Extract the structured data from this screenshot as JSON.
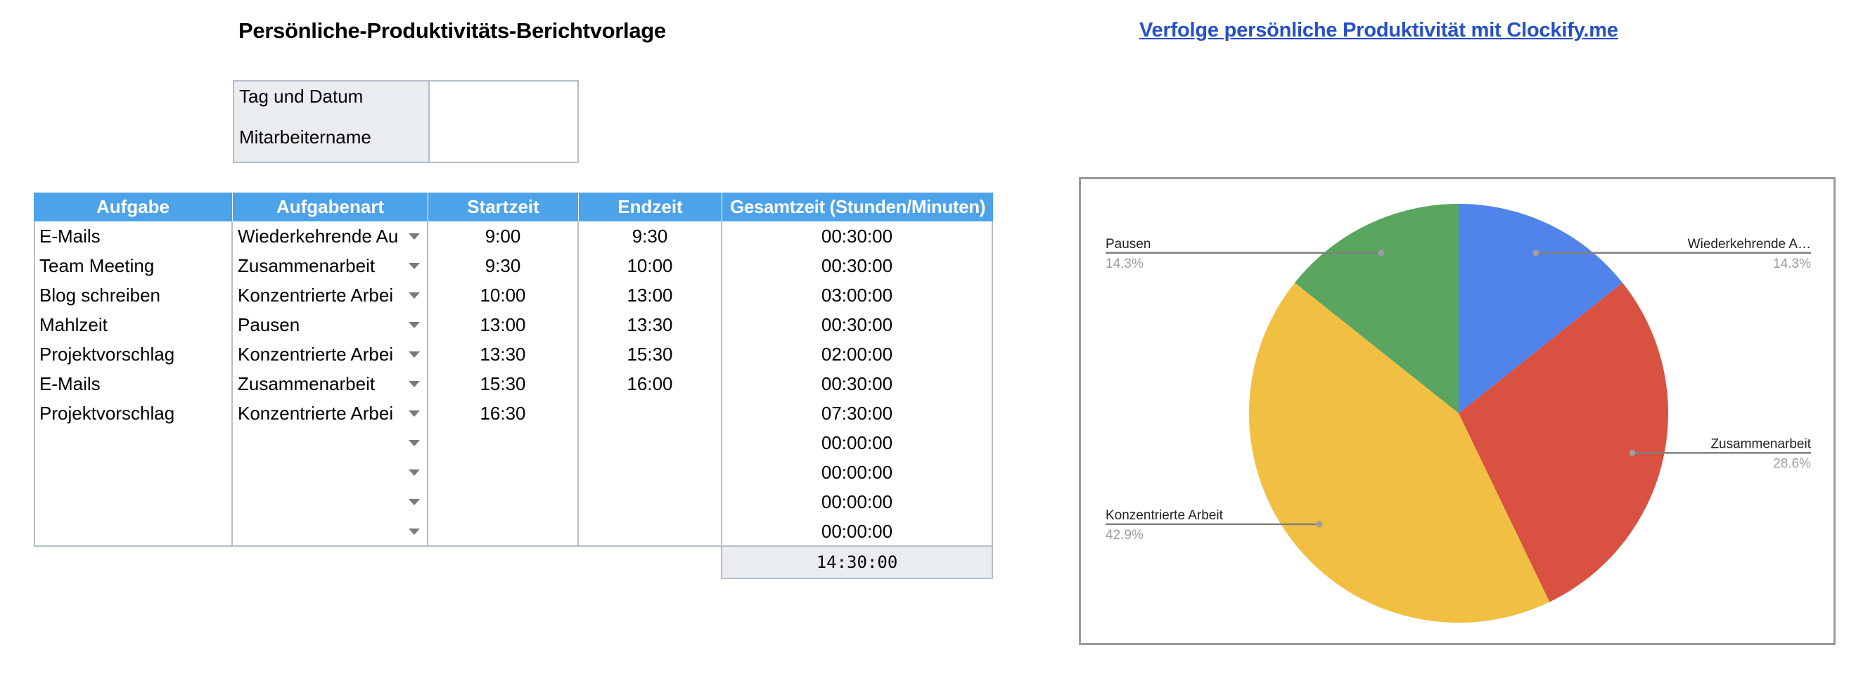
{
  "header": {
    "title": "Persönliche-Produktivitäts-Berichtvorlage",
    "link_text": "Verfolge persönliche Produktivität mit Clockify.me"
  },
  "info": {
    "rows": [
      {
        "label": "Tag und Datum",
        "value": ""
      },
      {
        "label": "Mitarbeitername",
        "value": ""
      }
    ]
  },
  "table": {
    "columns": [
      "Aufgabe",
      "Aufgabenart",
      "Startzeit",
      "Endzeit",
      "Gesamtzeit (Stunden/Minuten)"
    ],
    "rows": [
      {
        "task": "E-Mails",
        "type": "Wiederkehrende Au",
        "start": "9:00",
        "end": "9:30",
        "total": "00:30:00"
      },
      {
        "task": "Team Meeting",
        "type": "Zusammenarbeit",
        "start": "9:30",
        "end": "10:00",
        "total": "00:30:00"
      },
      {
        "task": "Blog schreiben",
        "type": "Konzentrierte Arbei",
        "start": "10:00",
        "end": "13:00",
        "total": "03:00:00"
      },
      {
        "task": "Mahlzeit",
        "type": "Pausen",
        "start": "13:00",
        "end": "13:30",
        "total": "00:30:00"
      },
      {
        "task": "Projektvorschlag",
        "type": "Konzentrierte Arbei",
        "start": "13:30",
        "end": "15:30",
        "total": "02:00:00"
      },
      {
        "task": "E-Mails",
        "type": "Zusammenarbeit",
        "start": "15:30",
        "end": "16:00",
        "total": "00:30:00"
      },
      {
        "task": "Projektvorschlag",
        "type": "Konzentrierte Arbei",
        "start": "16:30",
        "end": "",
        "total": "07:30:00"
      },
      {
        "task": "",
        "type": "",
        "start": "",
        "end": "",
        "total": "00:00:00"
      },
      {
        "task": "",
        "type": "",
        "start": "",
        "end": "",
        "total": "00:00:00"
      },
      {
        "task": "",
        "type": "",
        "start": "",
        "end": "",
        "total": "00:00:00"
      },
      {
        "task": "",
        "type": "",
        "start": "",
        "end": "",
        "total": "00:00:00"
      }
    ],
    "grand_total": "14:30:00",
    "dropdown_icon": "triangle-down"
  },
  "colors": {
    "header_bg": "#4da3ea",
    "link": "#2550c6",
    "label_bg": "#eaedf0"
  },
  "chart_data": {
    "type": "pie",
    "title": "",
    "start_angle_deg": 0,
    "direction": "clockwise",
    "slices": [
      {
        "label": "Wiederkehrende Aufgaben",
        "display_label": "Wiederkehrende A…",
        "percent_label": "14.3%",
        "value": 14.3,
        "color": "#5184ea"
      },
      {
        "label": "Zusammenarbeit",
        "display_label": "Zusammenarbeit",
        "percent_label": "28.6%",
        "value": 28.6,
        "color": "#d95141"
      },
      {
        "label": "Konzentrierte Arbeit",
        "display_label": "Konzentrierte Arbeit",
        "percent_label": "42.9%",
        "value": 42.9,
        "color": "#f1bf42"
      },
      {
        "label": "Pausen",
        "display_label": "Pausen",
        "percent_label": "14.3%",
        "value": 14.3,
        "color": "#5aa660"
      }
    ],
    "legend": "labeled-callouts"
  }
}
